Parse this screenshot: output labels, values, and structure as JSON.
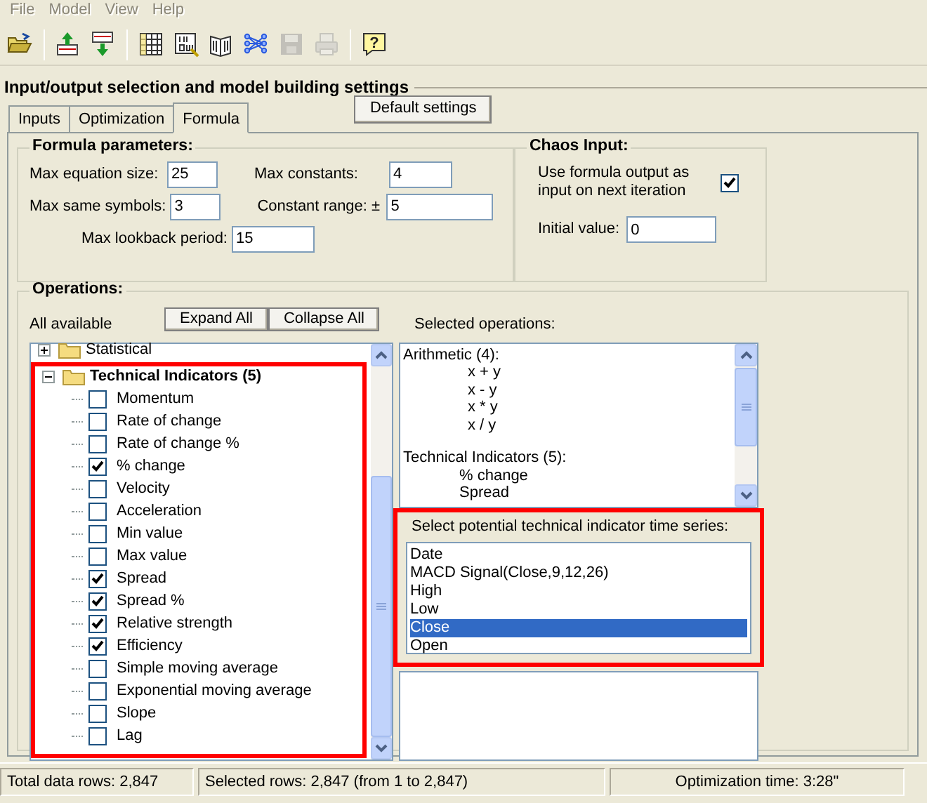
{
  "menu": [
    {
      "label": "File",
      "disabled": true
    },
    {
      "label": "Model",
      "disabled": true
    },
    {
      "label": "View",
      "disabled": true
    },
    {
      "label": "Help",
      "disabled": true
    }
  ],
  "toolbar": [
    {
      "kind": "open",
      "disabled": false
    },
    {
      "kind": "sep"
    },
    {
      "kind": "upload",
      "disabled": false
    },
    {
      "kind": "download",
      "disabled": false
    },
    {
      "kind": "sep"
    },
    {
      "kind": "table",
      "disabled": false
    },
    {
      "kind": "inout",
      "disabled": false
    },
    {
      "kind": "book",
      "disabled": false
    },
    {
      "kind": "network",
      "disabled": false
    },
    {
      "kind": "save",
      "disabled": true
    },
    {
      "kind": "print",
      "disabled": true
    },
    {
      "kind": "sep"
    },
    {
      "kind": "help",
      "disabled": false,
      "glyph": "?"
    }
  ],
  "settings": {
    "title": "Input/output selection and model building settings",
    "tabs": [
      {
        "label": "Inputs",
        "selected": false
      },
      {
        "label": "Optimization",
        "selected": false
      },
      {
        "label": "Formula",
        "selected": true
      }
    ],
    "default_button": "Default settings"
  },
  "formula_parameters": {
    "title": "Formula parameters:",
    "rows": [
      [
        {
          "label": "Max equation size:",
          "value": "25"
        },
        {
          "label": "Max constants:",
          "value": "4"
        }
      ],
      [
        {
          "label": "Max same symbols:",
          "value": "3"
        },
        {
          "label": "Constant range: ±",
          "value": "5"
        }
      ],
      [
        {
          "label": "Max lookback period:",
          "value": "15"
        }
      ]
    ]
  },
  "chaos_input": {
    "title": "Chaos Input:",
    "checkbox_label": "Use formula output as input on next iteration",
    "checked": true,
    "initial_label": "Initial value:",
    "initial_value": "0"
  },
  "operations": {
    "title": "Operations:",
    "available_label": "All available",
    "buttons": [
      "Expand All",
      "Collapse All"
    ],
    "tree": [
      {
        "label": "Statistical",
        "expanded": false
      },
      {
        "label": "Technical Indicators (5)",
        "expanded": true,
        "children": [
          {
            "label": "Momentum",
            "checked": false
          },
          {
            "label": "Rate of change",
            "checked": false
          },
          {
            "label": "Rate of change %",
            "checked": false
          },
          {
            "label": "% change",
            "checked": true
          },
          {
            "label": "Velocity",
            "checked": false
          },
          {
            "label": "Acceleration",
            "checked": false
          },
          {
            "label": "Min value",
            "checked": false
          },
          {
            "label": "Max value",
            "checked": false
          },
          {
            "label": "Spread",
            "checked": true
          },
          {
            "label": "Spread %",
            "checked": true
          },
          {
            "label": "Relative strength",
            "checked": true
          },
          {
            "label": "Efficiency",
            "checked": true
          },
          {
            "label": "Simple moving average",
            "checked": false
          },
          {
            "label": "Exponential moving average",
            "checked": false
          },
          {
            "label": "Slope",
            "checked": false
          },
          {
            "label": "Lag",
            "checked": false
          }
        ]
      }
    ],
    "selected_label": "Selected operations:",
    "selected_operations": [
      {
        "heading": "Arithmetic (4):",
        "items": [
          "x + y",
          "x - y",
          "x * y",
          "x / y"
        ]
      },
      {
        "heading": "Technical Indicators (5):",
        "items": [
          "% change",
          "Spread"
        ]
      }
    ],
    "series_label": "Select potential technical indicator time series:",
    "series": [
      {
        "label": "Date",
        "selected": false
      },
      {
        "label": "MACD Signal(Close,9,12,26)",
        "selected": false
      },
      {
        "label": "High",
        "selected": false
      },
      {
        "label": "Low",
        "selected": false
      },
      {
        "label": "Close",
        "selected": true
      },
      {
        "label": "Open",
        "selected": false
      }
    ]
  },
  "status_bar": [
    "Total data rows: 2,847",
    "Selected rows: 2,847  (from 1 to 2,847)",
    "Optimization time: 3:28\""
  ]
}
